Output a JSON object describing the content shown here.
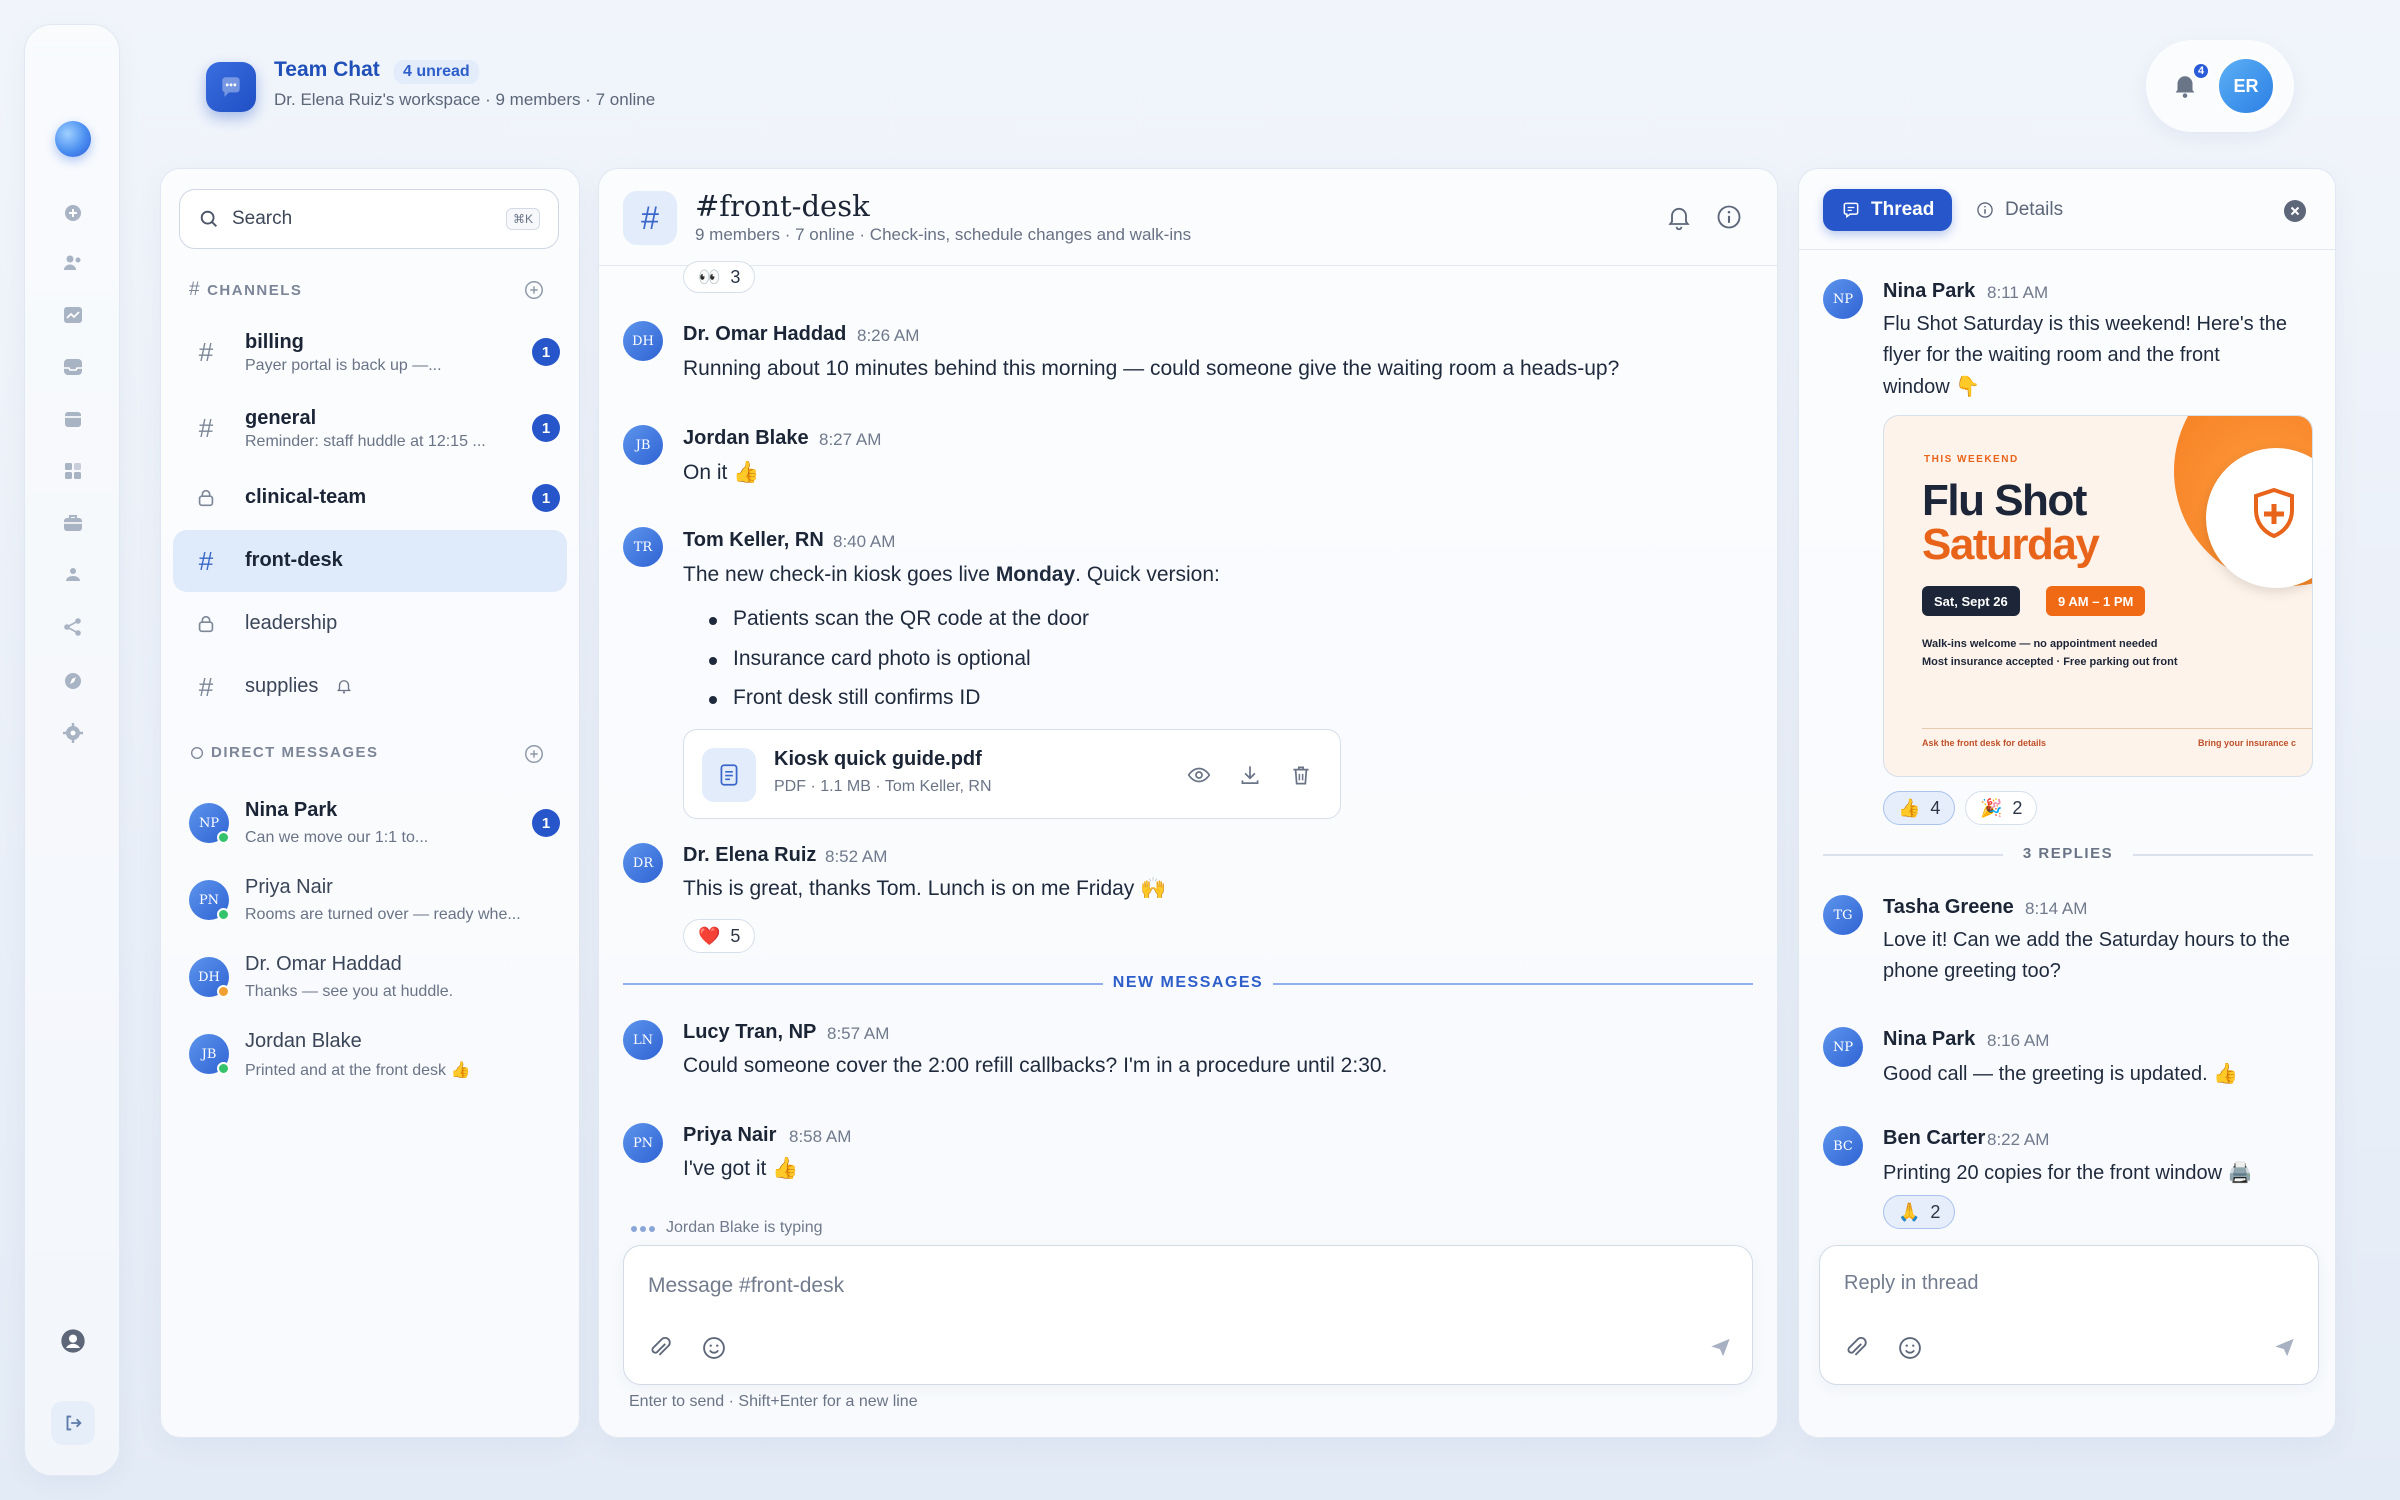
{
  "app": {
    "title": "Team Chat",
    "unread": "4 unread",
    "subtitle": "Dr. Elena Ruiz's workspace · 9 members · 7 online",
    "notif_count": "4",
    "user_initials": "ER",
    "accent": "#2656c9"
  },
  "rail": {
    "icons": [
      "plus-icon",
      "users-icon",
      "chart-icon",
      "inbox-icon",
      "calendar-icon",
      "apps-icon",
      "briefcase-icon",
      "team-icon",
      "share-icon",
      "compass-icon",
      "settings-icon"
    ],
    "bottom": [
      "profile-icon",
      "logout-icon"
    ]
  },
  "sidebar": {
    "search_placeholder": "Search",
    "search_shortcut": "⌘K",
    "channels_label": "CHANNELS",
    "channels": [
      {
        "name": "billing",
        "preview": "Payer portal is back up —...",
        "badge": "1",
        "type": "hash"
      },
      {
        "name": "general",
        "preview": "Reminder: staff huddle at 12:15 ...",
        "badge": "1",
        "type": "hash"
      },
      {
        "name": "clinical-team",
        "preview": "",
        "badge": "1",
        "type": "lock"
      },
      {
        "name": "front-desk",
        "preview": "",
        "badge": "",
        "type": "hash",
        "active": true
      },
      {
        "name": "leadership",
        "preview": "",
        "badge": "",
        "type": "lock"
      },
      {
        "name": "supplies",
        "preview": "",
        "badge": "",
        "type": "hash",
        "muted": true
      }
    ],
    "dm_label": "DIRECT MESSAGES",
    "dms": [
      {
        "initials": "NP",
        "name": "Nina Park",
        "preview": "Can we move our 1:1 to...",
        "badge": "1",
        "status": "#34c36b"
      },
      {
        "initials": "PN",
        "name": "Priya Nair",
        "preview": "Rooms are turned over — ready whe...",
        "badge": "",
        "status": "#34c36b"
      },
      {
        "initials": "DH",
        "name": "Dr. Omar Haddad",
        "preview": "Thanks — see you at huddle.",
        "badge": "",
        "status": "#f0a030"
      },
      {
        "initials": "JB",
        "name": "Jordan Blake",
        "preview": "Printed and at the front desk 👍",
        "badge": "",
        "status": "#34c36b"
      }
    ]
  },
  "channel": {
    "name": "#front-desk",
    "subtitle": "9 members · 7 online · Check-ins, schedule changes and walk-ins",
    "top_reaction": {
      "emoji": "👀",
      "count": "3"
    },
    "messages": [
      {
        "initials": "DH",
        "author": "Dr. Omar Haddad",
        "time": "8:26 AM",
        "text": "Running about 10 minutes behind this morning — could someone give the waiting room a heads-up?"
      },
      {
        "initials": "JB",
        "author": "Jordan Blake",
        "time": "8:27 AM",
        "text": "On it 👍"
      },
      {
        "initials": "TR",
        "author": "Tom Keller, RN",
        "time": "8:40 AM",
        "text_a": "The new check-in kiosk goes live ",
        "text_b": "Monday",
        "text_c": ". Quick version:",
        "bullets": [
          "Patients scan the QR code at the door",
          "Insurance card photo is optional",
          "Front desk still confirms ID"
        ],
        "file": {
          "name": "Kiosk quick guide.pdf",
          "meta": "PDF · 1.1 MB · Tom Keller, RN"
        }
      },
      {
        "initials": "DR",
        "author": "Dr. Elena Ruiz",
        "time": "8:52 AM",
        "text": "This is great, thanks Tom. Lunch is on me Friday 🙌",
        "reaction": {
          "emoji": "❤️",
          "count": "5"
        }
      },
      {
        "initials": "LN",
        "author": "Lucy Tran, NP",
        "time": "8:57 AM",
        "text": "Could someone cover the 2:00 refill callbacks? I'm in a procedure until 2:30."
      },
      {
        "initials": "PN",
        "author": "Priya Nair",
        "time": "8:58 AM",
        "text": "I've got it 👍"
      }
    ],
    "new_messages_label": "NEW MESSAGES",
    "typing": "Jordan Blake is typing",
    "composer_placeholder": "Message #front-desk",
    "hint": "Enter to send · Shift+Enter for a new line"
  },
  "thread": {
    "tab_thread": "Thread",
    "tab_details": "Details",
    "parent": {
      "initials": "NP",
      "author": "Nina Park",
      "time": "8:11 AM",
      "lines": [
        "Flu Shot Saturday is this weekend! Here's the",
        "flyer for the waiting room and the front",
        "window 👇"
      ]
    },
    "flyer": {
      "kicker": "THIS WEEKEND",
      "title_1": "Flu Shot",
      "title_2": "Saturday",
      "date": "Sat, Sept 26",
      "hours": "9 AM – 1 PM",
      "line_1": "Walk-ins welcome — no appointment needed",
      "line_2": "Most insurance accepted · Free parking out front",
      "footer_left": "Ask the front desk for details",
      "footer_right": "Bring your insurance c"
    },
    "parent_reactions": [
      {
        "emoji": "👍",
        "count": "4"
      },
      {
        "emoji": "🎉",
        "count": "2"
      }
    ],
    "replies_label": "3 REPLIES",
    "replies": [
      {
        "initials": "TG",
        "author": "Tasha Greene",
        "time": "8:14 AM",
        "lines": [
          "Love it! Can we add the Saturday hours to the",
          "phone greeting too?"
        ]
      },
      {
        "initials": "NP",
        "author": "Nina Park",
        "time": "8:16 AM",
        "lines": [
          "Good call — the greeting is updated. 👍"
        ]
      },
      {
        "initials": "BC",
        "author": "Ben Carter",
        "time": "8:22 AM",
        "lines": [
          "Printing 20 copies for the front window 🖨️"
        ],
        "reaction": {
          "emoji": "🙏",
          "count": "2"
        }
      }
    ],
    "composer_placeholder": "Reply in thread"
  }
}
